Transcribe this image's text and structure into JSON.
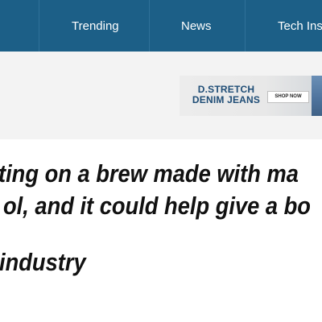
{
  "nav": {
    "items": [
      "Trending",
      "News",
      "Tech Insi"
    ]
  },
  "ad": {
    "brand_line1": "D.STRETCH",
    "brand_line2": "DENIM JEANS",
    "button": "SHOP NOW"
  },
  "headline": {
    "lines": [
      "ting on a brew made with ma",
      "ol, and it could help give a bo",
      "industry"
    ]
  },
  "colors": {
    "nav_bg": "#1c5f87",
    "ad_brand": "#1e4c75"
  }
}
